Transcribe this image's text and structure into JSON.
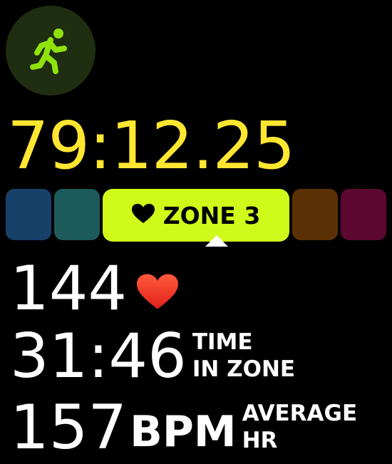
{
  "workout": {
    "icon": "running-figure-icon",
    "accent": "#8fe30b"
  },
  "timer": {
    "elapsed": "79:12.25",
    "color": "#ffe631"
  },
  "zones": {
    "active_label": "ZONE 3",
    "active_color": "#d0fa1a",
    "colors": [
      "#18416a",
      "#1d5a5b",
      "#d0fa1a",
      "#5c3005",
      "#5c0830"
    ]
  },
  "heart_rate": {
    "value": "144",
    "icon": "heart-icon"
  },
  "time_in_zone": {
    "value": "31:46",
    "label_line1": "TIME",
    "label_line2": "IN ZONE"
  },
  "average_hr": {
    "value": "157",
    "unit": "BPM",
    "label_line1": "AVERAGE",
    "label_line2": "HR"
  }
}
